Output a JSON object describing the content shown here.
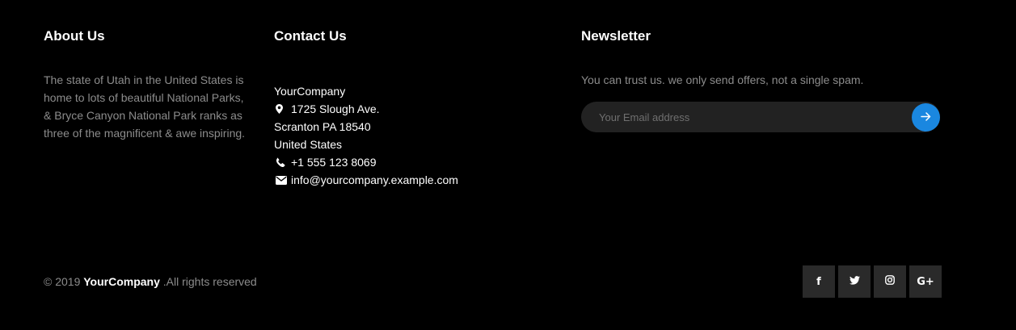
{
  "about": {
    "title": "About Us",
    "text": "The state of Utah in the United States is home to lots of beautiful National Parks, & Bryce Canyon National Park ranks as three of the magnificent & awe inspiring."
  },
  "contact": {
    "title": "Contact Us",
    "company": "YourCompany",
    "street": "1725 Slough Ave.",
    "city": "Scranton PA 18540",
    "country": "United States",
    "phone": "+1 555 123 8069",
    "email": "info@yourcompany.example.com",
    "icons": [
      "map-marker-icon",
      "phone-icon",
      "envelope-icon"
    ]
  },
  "newsletter": {
    "title": "Newsletter",
    "text": "You can trust us. we only send offers, not a single spam.",
    "placeholder": "Your Email address",
    "submit_icon": "arrow-right-icon",
    "accent": "#1a87e0"
  },
  "footer": {
    "copyright_prefix": "© 2019 ",
    "brand": "YourCompany",
    "copyright_suffix": " .All rights reserved"
  },
  "social": {
    "icons": [
      "facebook-icon",
      "twitter-icon",
      "instagram-icon",
      "google-plus-icon"
    ],
    "facebook_glyph": "f",
    "google_glyph": "G+"
  }
}
